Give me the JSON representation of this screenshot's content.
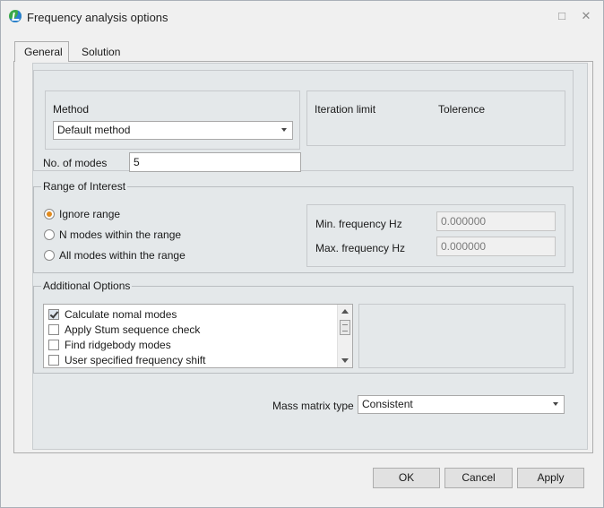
{
  "window": {
    "title": "Frequency analysis options"
  },
  "tabs": [
    {
      "label": "General"
    },
    {
      "label": "Solution"
    }
  ],
  "method_group": {
    "method_label": "Method",
    "method_value": "Default method",
    "iteration_limit_label": "Iteration limit",
    "tolerance_label": "Tolerence",
    "modes_label": "No. of modes",
    "modes_value": "5"
  },
  "range": {
    "legend": "Range of Interest",
    "options": [
      {
        "label": "Ignore range",
        "checked": true
      },
      {
        "label": "N modes within the range",
        "checked": false
      },
      {
        "label": "All modes within the range",
        "checked": false
      }
    ],
    "min_label": "Min. frequency Hz",
    "min_value": "0.000000",
    "max_label": "Max. frequency Hz",
    "max_value": "0.000000"
  },
  "additional": {
    "legend": "Additional Options",
    "items": [
      {
        "label": "Calculate nomal modes",
        "checked": true
      },
      {
        "label": "Apply Stum sequence check",
        "checked": false
      },
      {
        "label": "Find ridgebody modes",
        "checked": false
      },
      {
        "label": "User specified frequency shift",
        "checked": false
      }
    ]
  },
  "mass_matrix": {
    "label": "Mass matrix type",
    "value": "Consistent"
  },
  "buttons": {
    "ok": "OK",
    "cancel": "Cancel",
    "apply": "Apply"
  },
  "colors": {
    "accent_radio": "#e08a1e",
    "panel_bg": "#e4e8ea",
    "window_bg": "#f0f0f0"
  }
}
